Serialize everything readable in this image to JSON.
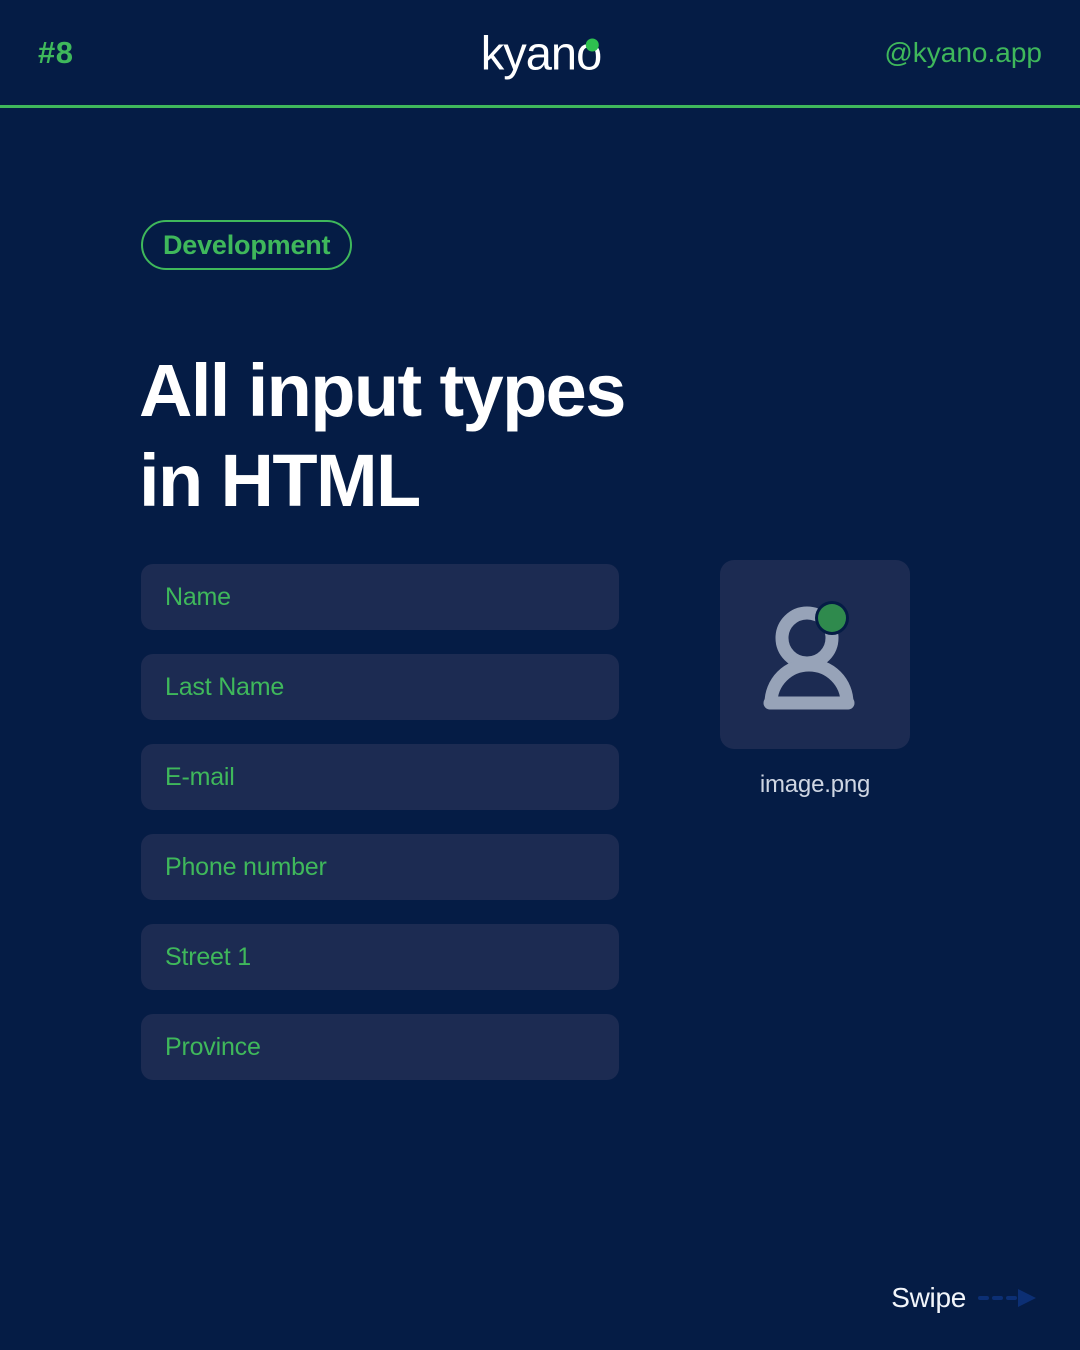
{
  "header": {
    "issue_number": "#8",
    "logo_text": "kyano",
    "logo_dot_icon": "green-dot-icon",
    "handle": "@kyano.app",
    "accent_color": "#3fb85b",
    "divider_color": "#3fb85b"
  },
  "content": {
    "badge_label": "Development",
    "title": "All input types\nin HTML"
  },
  "form": {
    "fields": [
      {
        "placeholder": "Name",
        "name": "name-input"
      },
      {
        "placeholder": "Last Name",
        "name": "last-name-input"
      },
      {
        "placeholder": "E-mail",
        "name": "email-input"
      },
      {
        "placeholder": "Phone number",
        "name": "phone-number-input"
      },
      {
        "placeholder": "Street 1",
        "name": "street-input"
      },
      {
        "placeholder": "Province",
        "name": "province-input"
      }
    ]
  },
  "upload": {
    "icon": "avatar-icon",
    "file_name": "image.png"
  },
  "footer": {
    "swipe_label": "Swipe",
    "swipe_icon": "dashed-arrow-right-icon"
  },
  "theme": {
    "background": "#051c45",
    "surface": "#1c2b52",
    "accent_green": "#3fb85b",
    "text_light": "#ffffff",
    "text_muted": "#cfd6e3",
    "arrow_blue": "#0c2f74",
    "avatar_gray": "#97a3b8",
    "avatar_green": "#2f8a4d"
  }
}
